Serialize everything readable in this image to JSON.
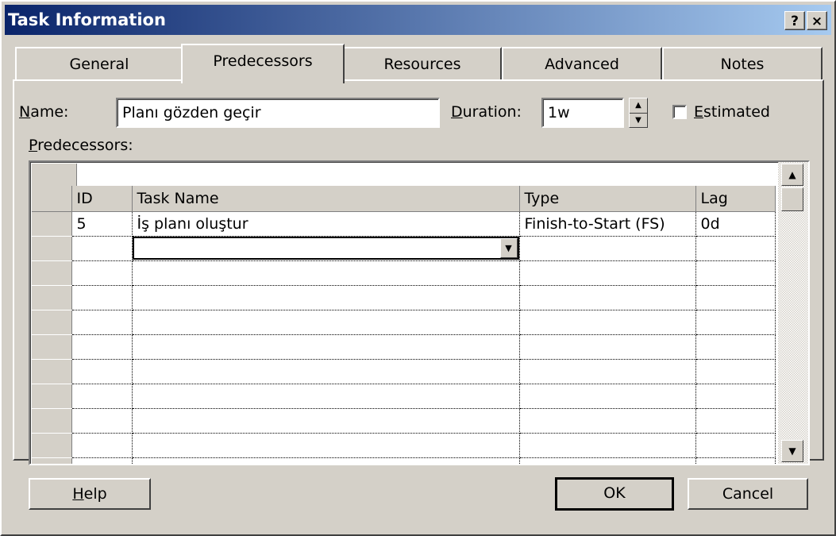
{
  "window": {
    "title": "Task Information",
    "help_glyph": "?",
    "close_glyph": "×"
  },
  "tabs": [
    "General",
    "Predecessors",
    "Resources",
    "Advanced",
    "Notes"
  ],
  "active_tab": "Predecessors",
  "name_label_u": "N",
  "name_label_rest": "ame:",
  "name_value": "Planı gözden geçir",
  "duration_label_u": "D",
  "duration_label_rest": "uration:",
  "duration_value": "1w",
  "estimated_label_u": "E",
  "estimated_label_rest": "stimated",
  "estimated_checked": false,
  "predecessors_label_u": "P",
  "predecessors_label_rest": "redecessors:",
  "grid": {
    "columns": [
      "ID",
      "Task Name",
      "Type",
      "Lag"
    ],
    "rows": [
      {
        "id": "5",
        "task_name": "İş planı oluştur",
        "type": "Finish-to-Start (FS)",
        "lag": "0d"
      }
    ],
    "editing_cell": "Task Name"
  },
  "buttons": {
    "help_u": "H",
    "help_rest": "elp",
    "ok": "OK",
    "cancel": "Cancel"
  }
}
